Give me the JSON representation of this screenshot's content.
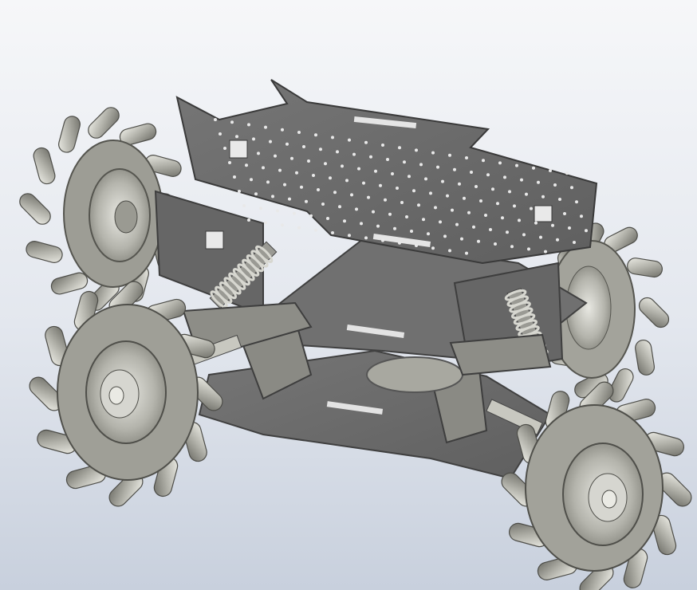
{
  "scene": {
    "background_top": "#f6f7f9",
    "background_bottom": "#c8d0dd",
    "plate_color": "#6b6b6b",
    "plate_edge": "#4a4a4a",
    "hole_color": "#e9e9e9",
    "wheel_metal": "#c4c4be",
    "wheel_dark": "#8e8e86",
    "roller_color": "#b9b9b2",
    "spring_color": "#d7d7d0"
  }
}
